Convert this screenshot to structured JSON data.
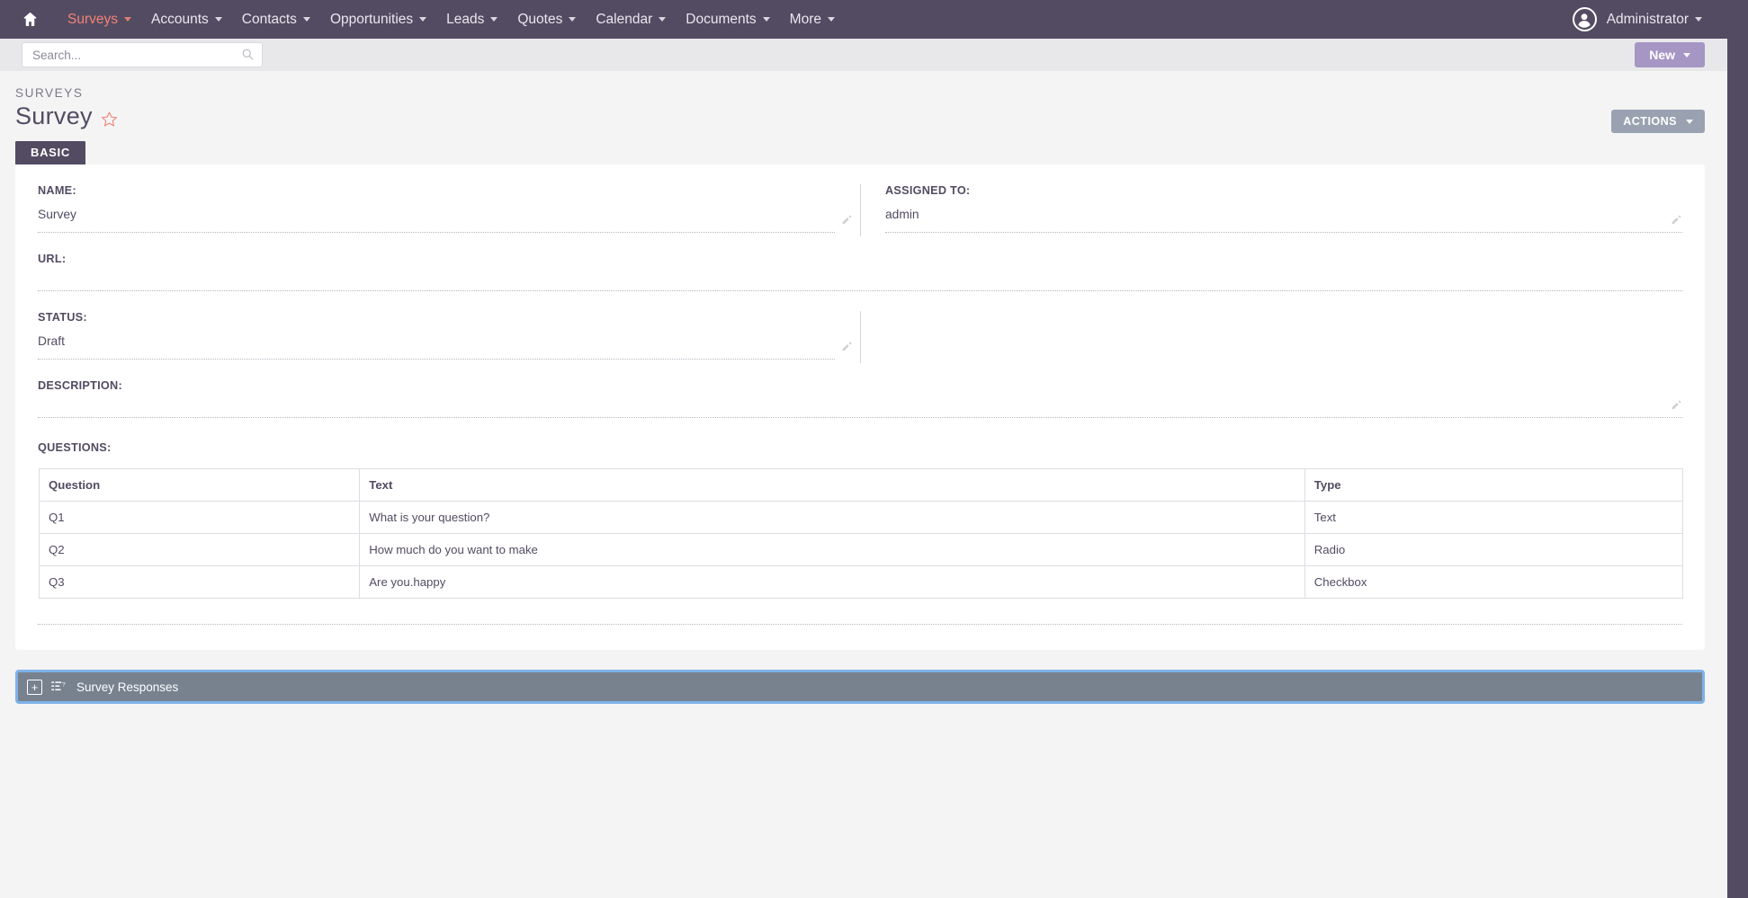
{
  "topnav": {
    "home_icon": "home-icon",
    "items": [
      {
        "label": "Surveys",
        "active": true
      },
      {
        "label": "Accounts",
        "active": false
      },
      {
        "label": "Contacts",
        "active": false
      },
      {
        "label": "Opportunities",
        "active": false
      },
      {
        "label": "Leads",
        "active": false
      },
      {
        "label": "Quotes",
        "active": false
      },
      {
        "label": "Calendar",
        "active": false
      },
      {
        "label": "Documents",
        "active": false
      },
      {
        "label": "More",
        "active": false
      }
    ],
    "user": {
      "label": "Administrator",
      "avatar_icon": "user-avatar-icon"
    }
  },
  "search": {
    "placeholder": "Search...",
    "value": "",
    "icon": "search-icon"
  },
  "toolbar": {
    "new_label": "New",
    "actions_label": "ACTIONS"
  },
  "header": {
    "breadcrumb": "SURVEYS",
    "title": "Survey",
    "favorite_icon": "star-outline-icon"
  },
  "tabs": [
    {
      "label": "BASIC",
      "active": true
    }
  ],
  "fields": {
    "name": {
      "label": "NAME:",
      "value": "Survey",
      "edit_icon": "pencil-icon"
    },
    "assigned_to": {
      "label": "ASSIGNED TO:",
      "value": "admin",
      "edit_icon": "pencil-icon"
    },
    "url": {
      "label": "URL:",
      "value": ""
    },
    "status": {
      "label": "STATUS:",
      "value": "Draft",
      "edit_icon": "pencil-icon"
    },
    "description": {
      "label": "DESCRIPTION:",
      "value": "",
      "edit_icon": "pencil-icon"
    },
    "questions": {
      "label": "QUESTIONS:"
    }
  },
  "questions_table": {
    "columns": [
      "Question",
      "Text",
      "Type"
    ],
    "rows": [
      {
        "question": "Q1",
        "text": "What is your question?",
        "type": "Text"
      },
      {
        "question": "Q2",
        "text": "How much do you want to make",
        "type": "Radio"
      },
      {
        "question": "Q3",
        "text": "Are you.happy",
        "type": "Checkbox"
      }
    ]
  },
  "responses_panel": {
    "title": "Survey Responses",
    "expand_label": "+",
    "icon": "survey-list-icon"
  },
  "colors": {
    "nav_background": "#534b62",
    "accent_active_nav": "#f08377",
    "new_button": "#a596c4",
    "actions_button": "#9aa1b0",
    "panel_background": "#78828f",
    "panel_border": "#7eb2e8",
    "page_background": "#f4f4f5",
    "text": "#534b62"
  }
}
